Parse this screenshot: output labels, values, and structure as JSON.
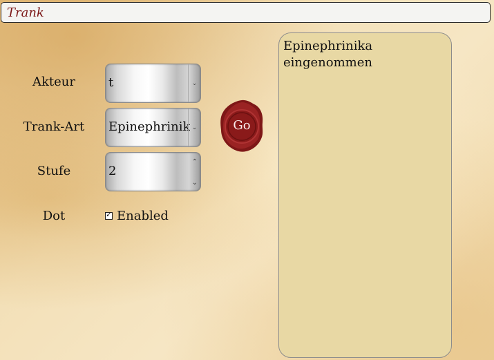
{
  "header": {
    "title": "Trank"
  },
  "form": {
    "akteur": {
      "label": "Akteur",
      "value": "t"
    },
    "trank_art": {
      "label": "Trank-Art",
      "value": "Epinephrinika"
    },
    "stufe": {
      "label": "Stufe",
      "value": "2"
    },
    "dot": {
      "label": "Dot",
      "checked": true,
      "checkbox_label": "Enabled"
    }
  },
  "go_button": {
    "label": "Go"
  },
  "output": {
    "text": "Epinephrinika eingenommen"
  },
  "colors": {
    "title_text": "#7a1515",
    "seal_red": "#8e1c1c",
    "output_bg": "#e8d8a4"
  },
  "icons": {
    "select_chevron": "chevron-down-icon",
    "spin_up": "chevron-up-icon",
    "spin_down": "chevron-down-icon",
    "checkbox_tick": "check-icon"
  }
}
